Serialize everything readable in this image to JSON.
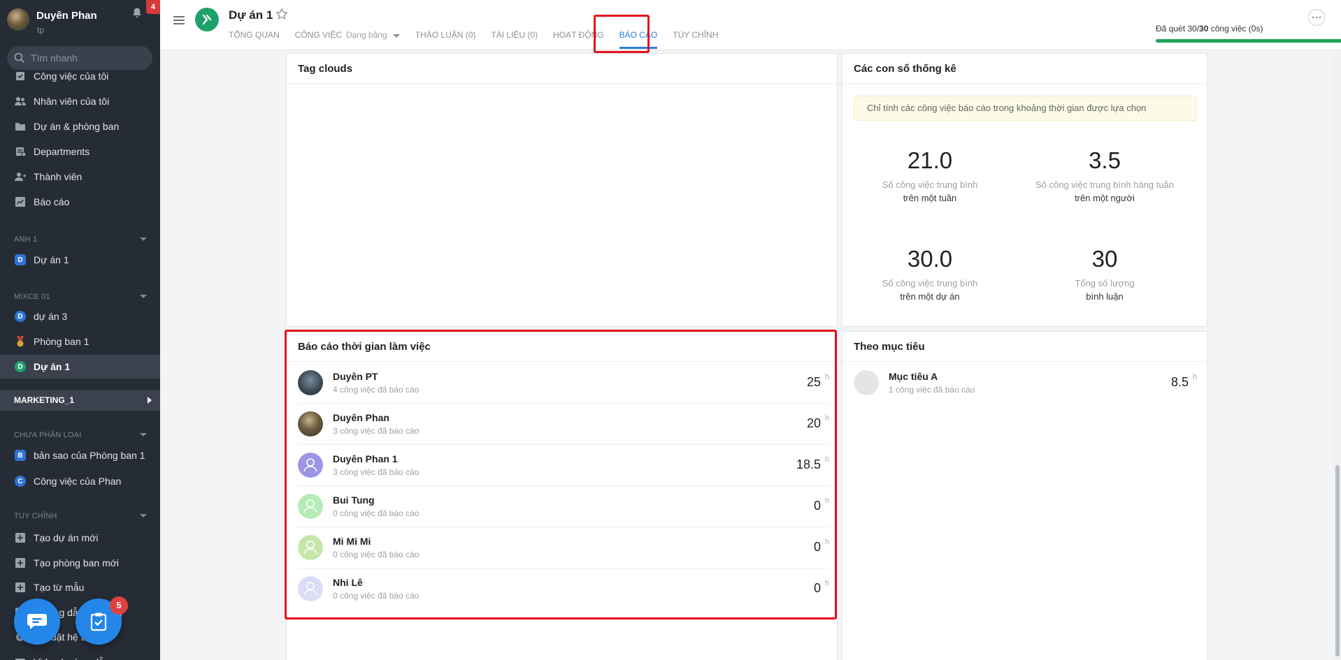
{
  "sidebar": {
    "user_name": "Duyên Phan",
    "user_sub": "tp",
    "notif_count": "4",
    "search_placeholder": "Tìm nhanh",
    "nav": [
      {
        "label": "Công việc của tôi",
        "icon": "task-check-icon"
      },
      {
        "label": "Nhân viên của tôi",
        "icon": "users-icon"
      },
      {
        "label": "Dự án & phòng ban",
        "icon": "folder-icon"
      },
      {
        "label": "Departments",
        "icon": "department-icon"
      },
      {
        "label": "Thành viên",
        "icon": "user-add-icon"
      },
      {
        "label": "Báo cáo",
        "icon": "chart-icon"
      }
    ],
    "sections": [
      {
        "title": "ANH 1",
        "items": [
          {
            "label": "Dự án 1",
            "badge": "D",
            "color": "#2e74d8",
            "round": false
          }
        ]
      },
      {
        "title": "MIXCE 01",
        "items": [
          {
            "label": "dự án 3",
            "badge": "D",
            "color": "#2e74d8",
            "round": true
          },
          {
            "label": "Phòng ban 1",
            "badge": "medal",
            "color": "#d7a233",
            "round": true
          },
          {
            "label": "Dự án 1",
            "badge": "D",
            "color": "#1ea26b",
            "round": true,
            "active": true
          }
        ]
      },
      {
        "title": "MARKETING_1",
        "group": true
      },
      {
        "title": "CHƯA PHÂN LOẠI",
        "items": [
          {
            "label": "bản sao của Phòng ban 1",
            "badge": "B",
            "color": "#2e74d8",
            "round": false
          },
          {
            "label": "Công việc của Phan",
            "badge": "C",
            "color": "#2e74d8",
            "round": true
          }
        ]
      },
      {
        "title": "TÙY CHỈNH",
        "items": [
          {
            "label": "Tạo dự án mới",
            "icon": "plus-square-icon"
          },
          {
            "label": "Tạo phòng ban mới",
            "icon": "plus-square-icon"
          },
          {
            "label": "Tạo từ mẫu",
            "icon": "plus-square-icon"
          },
          {
            "label": "Hướng dẫn sử dụng",
            "icon": "help-icon"
          },
          {
            "label": "Cài đặt hệ thống",
            "icon": "settings-icon"
          },
          {
            "label": "Video hướng dẫn",
            "icon": "video-icon"
          }
        ]
      }
    ],
    "task_badge": "5"
  },
  "header": {
    "project_title": "Dự án 1",
    "tabs": [
      {
        "label": "TỔNG QUAN"
      },
      {
        "label": "CÔNG VIỆC",
        "sub": "Dạng bảng",
        "dropdown": true
      },
      {
        "label": "THẢO LUẬN (0)"
      },
      {
        "label": "TÀI LIỆU (0)"
      },
      {
        "label": "HOẠT ĐỘNG"
      },
      {
        "label": "BÁO CÁO",
        "active": true
      },
      {
        "label": "TÙY CHỈNH"
      }
    ],
    "progress_pre": "Đã quét 30/",
    "progress_bold": "30",
    "progress_post": " công việc (0s)",
    "progress_fraction": 1.0
  },
  "tag_clouds": {
    "title": "Tag clouds"
  },
  "stats": {
    "title": "Các con số thống kê",
    "note": "Chỉ tính các công việc báo cáo trong khoảng thời gian được lựa chọn",
    "items": [
      {
        "value": "21.0",
        "line1": "Số công việc trung bình",
        "line2": "trên một tuần"
      },
      {
        "value": "3.5",
        "line1": "Số công việc trung bình hàng tuần",
        "line2": "trên một người"
      },
      {
        "value": "30.0",
        "line1": "Số công việc trung bình",
        "line2": "trên một dự án"
      },
      {
        "value": "30",
        "line1": "Tổng số lượng",
        "line2": "bình luận"
      }
    ]
  },
  "work_time": {
    "title": "Báo cáo thời gian làm việc",
    "unit": "h",
    "rows": [
      {
        "name": "Duyên PT",
        "sub": "4 công việc đã báo cáo",
        "value": "25",
        "avatar": "photo-a"
      },
      {
        "name": "Duyên Phan",
        "sub": "3 công việc đã báo cáo",
        "value": "20",
        "avatar": "photo-b"
      },
      {
        "name": "Duyên Phan 1",
        "sub": "3 công việc đã báo cáo",
        "value": "18.5",
        "avatar": "#9c95e6"
      },
      {
        "name": "Bui Tung",
        "sub": "0 công việc đã báo cáo",
        "value": "0",
        "avatar": "#b5ebb6"
      },
      {
        "name": "Mi Mi Mi",
        "sub": "0 công việc đã báo cáo",
        "value": "0",
        "avatar": "#c6e6a9"
      },
      {
        "name": "Nhi Lê",
        "sub": "0 công việc đã báo cáo",
        "value": "0",
        "avatar": "#dcdcf5"
      }
    ]
  },
  "goals": {
    "title": "Theo mục tiêu",
    "unit": "h",
    "rows": [
      {
        "name": "Mục tiêu A",
        "sub": "1 công việc đã báo cáo",
        "value": "8.5"
      }
    ]
  }
}
